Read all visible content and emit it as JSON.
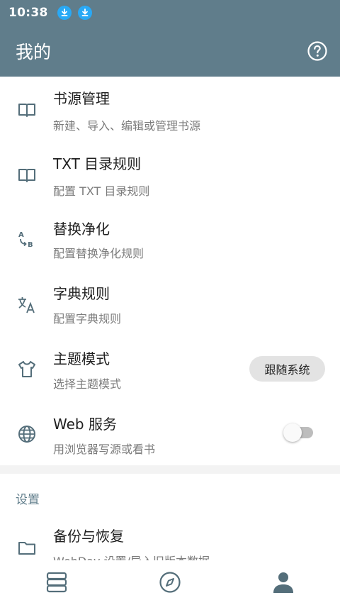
{
  "status_bar": {
    "time": "10:38"
  },
  "app_bar": {
    "title": "我的"
  },
  "items": [
    {
      "title": "书源管理",
      "subtitle": "新建、导入、编辑或管理书源",
      "icon": "book-icon"
    },
    {
      "title": "TXT 目录规则",
      "subtitle": "配置 TXT 目录规则",
      "icon": "book-icon"
    },
    {
      "title": "替换净化",
      "subtitle": "配置替换净化规则",
      "icon": "replace-ab-icon"
    },
    {
      "title": "字典规则",
      "subtitle": "配置字典规则",
      "icon": "translate-icon"
    },
    {
      "title": "主题模式",
      "subtitle": "选择主题模式",
      "icon": "tshirt-icon",
      "value": "跟随系统"
    },
    {
      "title": "Web 服务",
      "subtitle": "用浏览器写源或看书",
      "icon": "globe-icon",
      "toggle_on": false
    }
  ],
  "settings_section": {
    "header": "设置",
    "items": [
      {
        "title": "备份与恢复",
        "subtitle": "WebDav 设置/导入旧版本数据",
        "icon": "folder-icon"
      }
    ]
  },
  "bottom_nav": [
    {
      "name": "bookshelf",
      "icon": "bookshelf-icon"
    },
    {
      "name": "explore",
      "icon": "compass-icon"
    },
    {
      "name": "my",
      "icon": "person-icon",
      "active": true
    }
  ],
  "colors": {
    "primary": "#607d8b",
    "download_badge": "#29a9f5",
    "chip_bg": "#e3e3e3",
    "subtitle": "#7b7b7b"
  }
}
